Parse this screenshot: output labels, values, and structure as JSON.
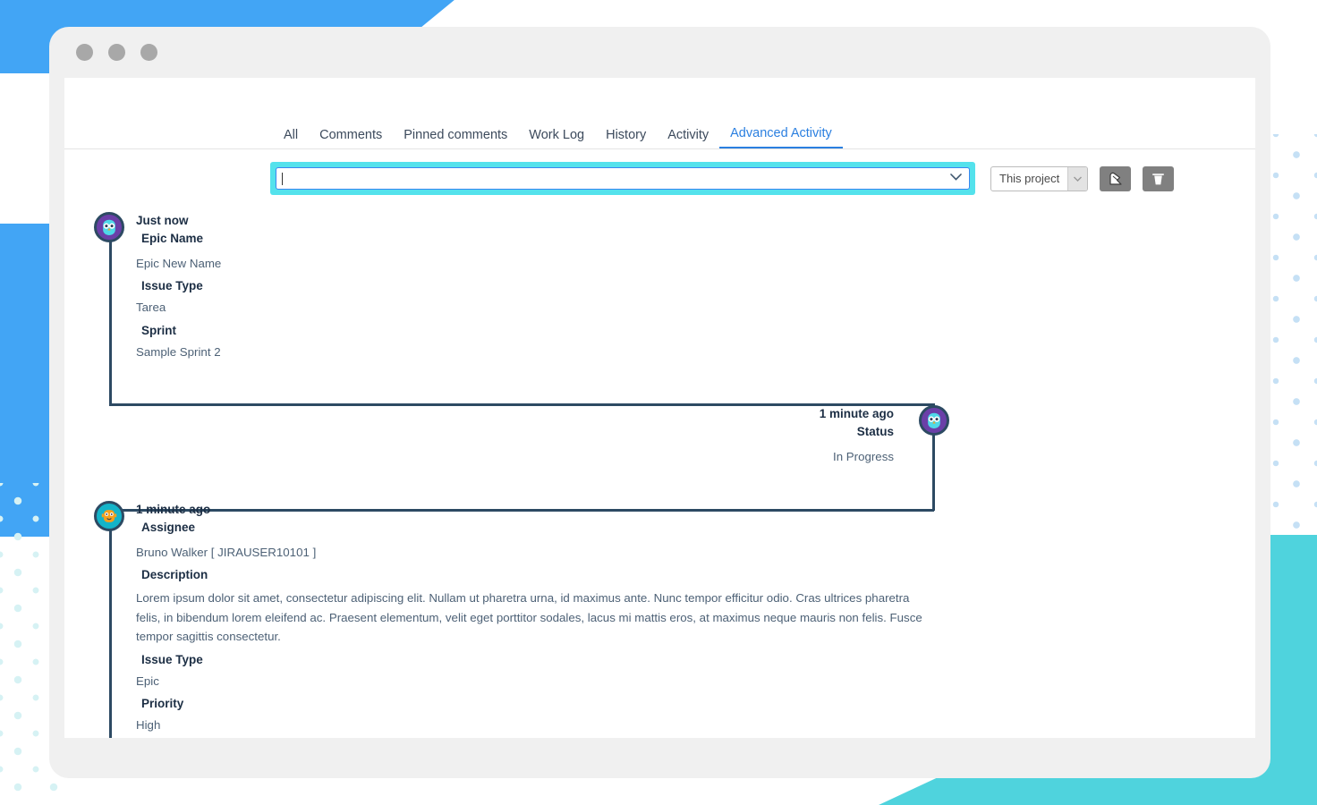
{
  "window": {
    "dots": [
      "dot-1",
      "dot-2",
      "dot-3"
    ]
  },
  "tabs": [
    {
      "label": "All",
      "active": false
    },
    {
      "label": "Comments",
      "active": false
    },
    {
      "label": "Pinned comments",
      "active": false
    },
    {
      "label": "Work Log",
      "active": false
    },
    {
      "label": "History",
      "active": false
    },
    {
      "label": "Activity",
      "active": false
    },
    {
      "label": "Advanced Activity",
      "active": true
    }
  ],
  "filter_bar": {
    "search_value": "",
    "search_placeholder": "",
    "scope_select": {
      "selected": "This project",
      "options": [
        "This project"
      ]
    },
    "buttons": [
      {
        "name": "export-icon",
        "glyph": "export"
      },
      {
        "name": "delete-icon",
        "glyph": "trash"
      }
    ]
  },
  "activities": [
    {
      "side": "left",
      "avatar": "owl",
      "time": "Just now",
      "title": "Epic Name",
      "fields": [
        {
          "label": "",
          "value": "Epic New Name"
        },
        {
          "label": "Issue Type",
          "value": "Tarea"
        },
        {
          "label": "Sprint",
          "value": "Sample Sprint 2"
        }
      ]
    },
    {
      "side": "right",
      "avatar": "owl",
      "time": "1 minute ago",
      "title": "Status",
      "fields": [
        {
          "label": "",
          "value": "In Progress"
        }
      ]
    },
    {
      "side": "left",
      "avatar": "bot",
      "time": "1 minute ago",
      "title": "Assignee",
      "fields": [
        {
          "label": "",
          "value": "Bruno Walker [ JIRAUSER10101 ]"
        },
        {
          "label": "Description",
          "value": "Lorem ipsum dolor sit amet, consectetur adipiscing elit. Nullam ut pharetra urna, id maximus ante. Nunc tempor efficitur odio. Cras ultrices pharetra felis, in bibendum lorem eleifend ac. Praesent elementum, velit eget porttitor sodales, lacus mi mattis eros, at maximus neque mauris non felis. Fusce tempor sagittis consectetur."
        },
        {
          "label": "Issue Type",
          "value": "Epic"
        },
        {
          "label": "Priority",
          "value": "High"
        }
      ]
    }
  ],
  "colors": {
    "accent_blue": "#2a7fe0",
    "highlight_cyan": "#54e2ec",
    "timeline_navy": "#2d4a63",
    "avatar_owl": "#6b3fa8",
    "avatar_bot": "#14b4c9",
    "deco_blue": "#42a5f5",
    "deco_teal": "#4fd3dd",
    "button_gray": "#808080"
  }
}
